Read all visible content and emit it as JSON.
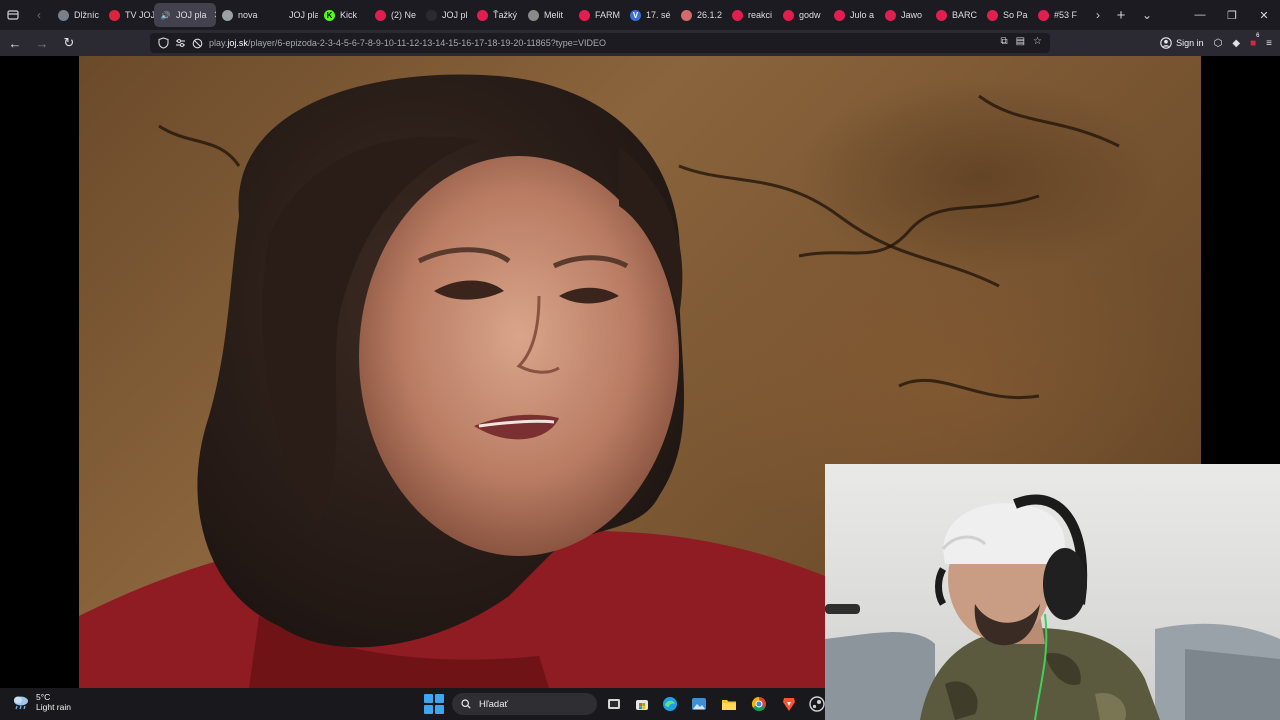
{
  "browser": {
    "tabs": [
      {
        "label": "Dlžníc",
        "favicon_color": "#7a7f8a",
        "favicon_glyph": ""
      },
      {
        "label": "TV JOJ",
        "favicon_color": "#d7263d",
        "favicon_glyph": ""
      },
      {
        "label": "JOJ pla",
        "favicon_color": "#cfcfd4",
        "favicon_glyph": "🔊",
        "active": true
      },
      {
        "label": "nova",
        "favicon_color": "#9aa0a6",
        "favicon_glyph": ""
      },
      {
        "label": "JOJ play",
        "favicon_color": "#1c1b22",
        "favicon_glyph": ""
      },
      {
        "label": "Kick",
        "favicon_color": "#53fc18",
        "favicon_glyph": "K"
      },
      {
        "label": "(2) Ne",
        "favicon_color": "#e01f4f",
        "favicon_glyph": ""
      },
      {
        "label": "JOJ pl",
        "favicon_color": "#2b2a33",
        "favicon_glyph": ""
      },
      {
        "label": "Ťažký",
        "favicon_color": "#e01f4f",
        "favicon_glyph": ""
      },
      {
        "label": "Melit",
        "favicon_color": "#8a8a8a",
        "favicon_glyph": ""
      },
      {
        "label": "FARM",
        "favicon_color": "#e01f4f",
        "favicon_glyph": ""
      },
      {
        "label": "17. sé",
        "favicon_color": "#3b6fd8",
        "favicon_glyph": "V"
      },
      {
        "label": "26.1.2",
        "favicon_color": "#d46a6a",
        "favicon_glyph": ""
      },
      {
        "label": "reakci",
        "favicon_color": "#e01f4f",
        "favicon_glyph": ""
      },
      {
        "label": "godw",
        "favicon_color": "#e01f4f",
        "favicon_glyph": ""
      },
      {
        "label": "Julo a",
        "favicon_color": "#e01f4f",
        "favicon_glyph": ""
      },
      {
        "label": "Jawo",
        "favicon_color": "#e01f4f",
        "favicon_glyph": ""
      },
      {
        "label": "BARC",
        "favicon_color": "#e01f4f",
        "favicon_glyph": ""
      },
      {
        "label": "So Pa",
        "favicon_color": "#e01f4f",
        "favicon_glyph": ""
      },
      {
        "label": "#53 F",
        "favicon_color": "#e01f4f",
        "favicon_glyph": ""
      }
    ],
    "url": {
      "prefix": "play.",
      "domain": "joj.sk",
      "path": "/player/6-epizoda-2-3-4-5-6-7-8-9-10-11-12-13-14-15-16-17-18-19-20-11865?type=VIDEO"
    },
    "sign_in_label": "Sign in",
    "extension_badge": "6"
  },
  "taskbar": {
    "weather": {
      "temperature": "5°C",
      "condition": "Light rain"
    },
    "search_placeholder": "Hľadať"
  }
}
